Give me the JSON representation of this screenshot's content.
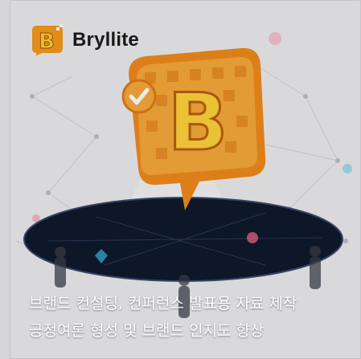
{
  "brand": {
    "name": "Bryllite",
    "accent": "#f39a1d",
    "accent_dark": "#d8771a",
    "dark": "#1a2230"
  },
  "caption": {
    "line1": "브랜드 컨설팅, 컨퍼런스 발표용 자료 제작",
    "line2": "긍정여론 형성 및 브랜드 인지도 향상"
  }
}
